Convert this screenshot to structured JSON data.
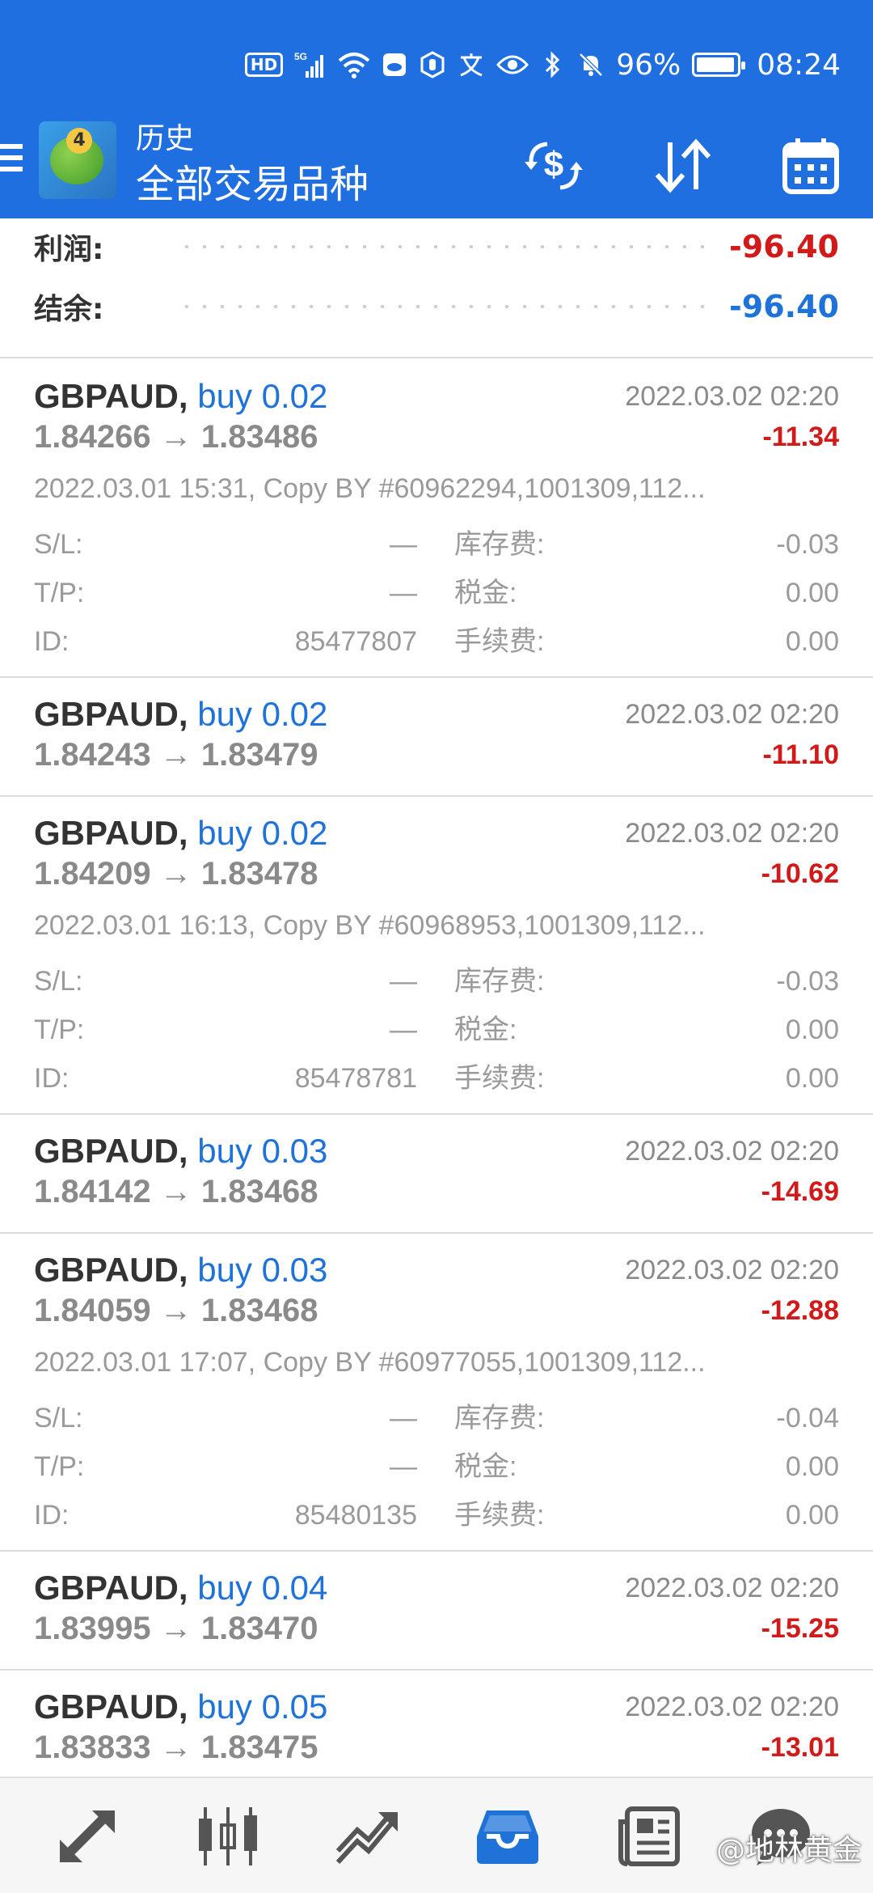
{
  "status_bar": {
    "hd": "HD",
    "network": "5G",
    "battery_text": "96%",
    "battery_level": 0.96,
    "time": "08:24"
  },
  "app_bar": {
    "subtitle": "历史",
    "title": "全部交易品种",
    "accent_color": "#1f6fe0"
  },
  "summary": {
    "profit_label": "利润:",
    "profit_value": "-96.40",
    "balance_label": "结余:",
    "balance_value": "-96.40",
    "profit_color": "#d11a1a",
    "balance_color": "#1f73d8"
  },
  "labels": {
    "sl": "S/L:",
    "tp": "T/P:",
    "id": "ID:",
    "swap": "库存费:",
    "tax": "税金:",
    "commission": "手续费:"
  },
  "deals": [
    {
      "symbol": "GBPAUD,",
      "type": "buy 0.02",
      "time": "2022.03.02 02:20",
      "open_price": "1.84266",
      "close_price": "1.83486",
      "arrow": "→",
      "profit": "-11.34",
      "comment": "2022.03.01 15:31, Copy BY #60962294,1001309,112...",
      "sl": "—",
      "tp": "—",
      "id": "85477807",
      "swap": "-0.03",
      "tax": "0.00",
      "commission": "0.00"
    },
    {
      "symbol": "GBPAUD,",
      "type": "buy 0.02",
      "time": "2022.03.02 02:20",
      "open_price": "1.84243",
      "close_price": "1.83479",
      "arrow": "→",
      "profit": "-11.10"
    },
    {
      "symbol": "GBPAUD,",
      "type": "buy 0.02",
      "time": "2022.03.02 02:20",
      "open_price": "1.84209",
      "close_price": "1.83478",
      "arrow": "→",
      "profit": "-10.62",
      "comment": "2022.03.01 16:13, Copy BY #60968953,1001309,112...",
      "sl": "—",
      "tp": "—",
      "id": "85478781",
      "swap": "-0.03",
      "tax": "0.00",
      "commission": "0.00"
    },
    {
      "symbol": "GBPAUD,",
      "type": "buy 0.03",
      "time": "2022.03.02 02:20",
      "open_price": "1.84142",
      "close_price": "1.83468",
      "arrow": "→",
      "profit": "-14.69"
    },
    {
      "symbol": "GBPAUD,",
      "type": "buy 0.03",
      "time": "2022.03.02 02:20",
      "open_price": "1.84059",
      "close_price": "1.83468",
      "arrow": "→",
      "profit": "-12.88",
      "comment": "2022.03.01 17:07, Copy BY #60977055,1001309,112...",
      "sl": "—",
      "tp": "—",
      "id": "85480135",
      "swap": "-0.04",
      "tax": "0.00",
      "commission": "0.00"
    },
    {
      "symbol": "GBPAUD,",
      "type": "buy 0.04",
      "time": "2022.03.02 02:20",
      "open_price": "1.83995",
      "close_price": "1.83470",
      "arrow": "→",
      "profit": "-15.25"
    },
    {
      "symbol": "GBPAUD,",
      "type": "buy 0.05",
      "time": "2022.03.02 02:20",
      "open_price": "1.83833",
      "close_price": "1.83475",
      "arrow": "→",
      "profit": "-13.01"
    }
  ],
  "bottom_nav": {
    "items": [
      {
        "icon": "quotes-icon"
      },
      {
        "icon": "chart-candles-icon"
      },
      {
        "icon": "trade-icon"
      },
      {
        "icon": "history-inbox-icon"
      },
      {
        "icon": "news-icon"
      },
      {
        "icon": "chat-icon"
      }
    ],
    "active_color": "#1f73d8",
    "watermark": "@地林黄金"
  }
}
